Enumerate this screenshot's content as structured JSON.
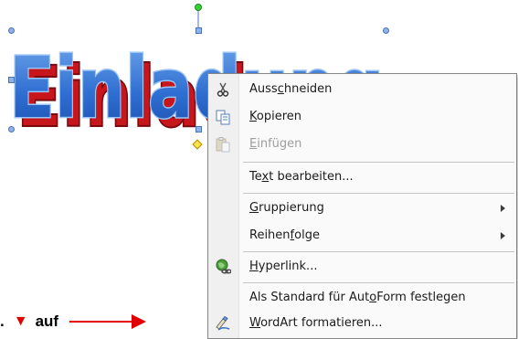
{
  "wordart": {
    "text": "Einladung"
  },
  "instruction": {
    "prefix": ".",
    "triangle": "▼",
    "word": "auf"
  },
  "menu": {
    "items": [
      {
        "id": "cut",
        "pre": "Auss",
        "u": "c",
        "post": "hneiden",
        "icon": "scissors-icon",
        "disabled": false
      },
      {
        "id": "copy",
        "pre": "",
        "u": "K",
        "post": "opieren",
        "icon": "copy-icon",
        "disabled": false
      },
      {
        "id": "paste",
        "pre": "",
        "u": "E",
        "post": "infügen",
        "icon": "paste-icon",
        "disabled": true
      },
      {
        "id": "edit-text",
        "pre": "Te",
        "u": "x",
        "post": "t bearbeiten...",
        "icon": "",
        "disabled": false
      },
      {
        "id": "grouping",
        "pre": "",
        "u": "G",
        "post": "ruppierung",
        "icon": "",
        "disabled": false,
        "submenu": true
      },
      {
        "id": "order",
        "pre": "Reihen",
        "u": "f",
        "post": "olge",
        "icon": "",
        "disabled": false,
        "submenu": true
      },
      {
        "id": "hyperlink",
        "pre": "",
        "u": "H",
        "post": "yperlink...",
        "icon": "hyperlink-globe-icon",
        "disabled": false
      },
      {
        "id": "set-default",
        "pre": "Als Standard für Aut",
        "u": "o",
        "post": "Form festlegen",
        "icon": "",
        "disabled": false
      },
      {
        "id": "format-wordart",
        "pre": "",
        "u": "W",
        "post": "ordArt formatieren...",
        "icon": "wordart-format-icon",
        "disabled": false
      }
    ]
  }
}
